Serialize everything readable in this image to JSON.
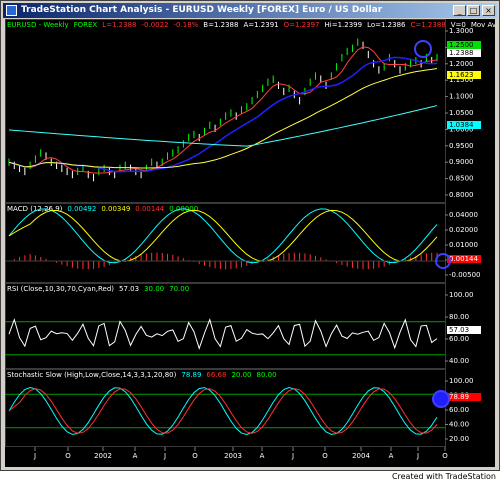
{
  "window": {
    "title": "TradeStation Chart Analysis - EURUSD  Weekly  [FOREX] Euro / US Dollar",
    "controls": {
      "minimize": "_",
      "maximize": "□",
      "close": "×"
    }
  },
  "price_panel": {
    "header": [
      {
        "text": "EURUSD - Weekly",
        "color": "#00ff00"
      },
      {
        "text": "FOREX",
        "color": "#00ff00"
      },
      {
        "text": "L=1.2388",
        "color": "#ff3030"
      },
      {
        "text": "-0.0022",
        "color": "#ff3030"
      },
      {
        "text": "-0.18%",
        "color": "#ff3030"
      },
      {
        "text": "B=1.2388",
        "color": "#ffffff"
      },
      {
        "text": "A=1.2391",
        "color": "#ffffff"
      },
      {
        "text": "O=1.2397",
        "color": "#ff3030"
      },
      {
        "text": "Hi=1.2399",
        "color": "#ffffff"
      },
      {
        "text": "Lo=1.2386",
        "color": "#ffffff"
      },
      {
        "text": "C=1.2388",
        "color": "#ff3030"
      },
      {
        "text": "V=0",
        "color": "#ffffff"
      },
      {
        "text": "Mov Avg 3 Lines (Clo...",
        "color": "#ffffff"
      }
    ],
    "y_ticks": [
      "1.3000",
      "1.2500",
      "1.2000",
      "1.1500",
      "1.1000",
      "1.0500",
      "1.0000",
      "0.9500",
      "0.9000",
      "0.8500",
      "0.8000"
    ],
    "markers": [
      {
        "text": "1.2500",
        "bg": "#00e000",
        "fg": "#000000"
      },
      {
        "text": "1.2388",
        "bg": "#ffffff",
        "fg": "#000000"
      },
      {
        "text": "1.1623",
        "bg": "#ffff00",
        "fg": "#000000"
      },
      {
        "text": "1.0384",
        "bg": "#00ffff",
        "fg": "#000000"
      }
    ]
  },
  "macd_panel": {
    "header": [
      {
        "text": "MACD (12,26,9)",
        "color": "#ffffff"
      },
      {
        "text": "0.00492",
        "color": "#00ffff"
      },
      {
        "text": "0.00349",
        "color": "#ffff00"
      },
      {
        "text": "0.00144",
        "color": "#ff3030"
      },
      {
        "text": "0.00000",
        "color": "#00ff00"
      }
    ],
    "y_ticks": [
      "0.04000",
      "0.02000",
      "0.01000",
      "0.00000",
      "-0.00500"
    ],
    "markers": [
      {
        "text": "0.00144",
        "bg": "#ff0000",
        "fg": "#ffffff"
      }
    ]
  },
  "rsi_panel": {
    "header": [
      {
        "text": "RSI (Close,10,30,70,Cyan,Red)",
        "color": "#ffffff"
      },
      {
        "text": "57.03",
        "color": "#ffffff"
      },
      {
        "text": "30.00",
        "color": "#00ff00"
      },
      {
        "text": "70.00",
        "color": "#00ff00"
      }
    ],
    "y_ticks": [
      "100.00",
      "80.00",
      "60.00",
      "40.00"
    ],
    "markers": [
      {
        "text": "57.03",
        "bg": "#ffffff",
        "fg": "#000000"
      }
    ]
  },
  "stoch_panel": {
    "header": [
      {
        "text": "Stochastic Slow (High,Low,Close,14,3,3,1,20,80)",
        "color": "#ffffff"
      },
      {
        "text": "78.89",
        "color": "#00ffff"
      },
      {
        "text": "66.68",
        "color": "#ff3030"
      },
      {
        "text": "20.00",
        "color": "#00ff00"
      },
      {
        "text": "80.00",
        "color": "#00ff00"
      }
    ],
    "y_ticks": [
      "100.00",
      "80.00",
      "60.00",
      "40.00",
      "20.00"
    ],
    "markers": [
      {
        "text": "78.89",
        "bg": "#ff0000",
        "fg": "#ffffff"
      }
    ]
  },
  "x_axis": {
    "labels": [
      "J",
      "O",
      "2002",
      "A",
      "J",
      "O",
      "2003",
      "A",
      "J",
      "O",
      "2004",
      "A",
      "J",
      "O"
    ]
  },
  "credit": "Created with TradeStation"
}
